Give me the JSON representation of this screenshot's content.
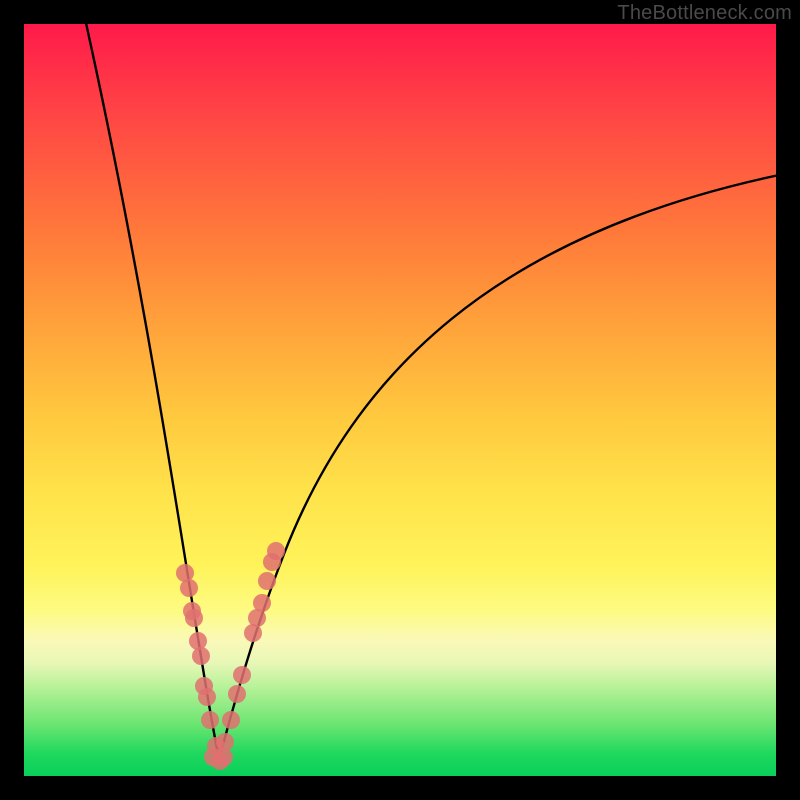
{
  "watermark": "TheBottleneck.com",
  "chart_data": {
    "type": "line",
    "title": "",
    "xlabel": "",
    "ylabel": "",
    "xlim": [
      0,
      100
    ],
    "ylim": [
      0,
      100
    ],
    "curve": {
      "name": "bottleneck-curve",
      "description": "V-shaped curve with minimum near x≈25",
      "x_min_at": 25,
      "left_branch_start_y": 100,
      "right_branch_end_y": 80
    },
    "series": [
      {
        "name": "left-dots",
        "x": [
          21.5,
          22.0,
          22.7,
          22.4,
          23.6,
          23.2,
          24.4,
          24.0,
          24.8,
          25.5
        ],
        "y": [
          27,
          25,
          21,
          22,
          16,
          18,
          10.5,
          12,
          7.5,
          4
        ]
      },
      {
        "name": "right-dots",
        "x": [
          26.8,
          27.5,
          29.0,
          28.3,
          30.5,
          31.6,
          32.3,
          31.0,
          33.0,
          33.6
        ],
        "y": [
          4.5,
          7.5,
          13.5,
          11,
          19,
          23,
          26,
          21,
          28.5,
          30
        ]
      },
      {
        "name": "bottom-dots",
        "x": [
          25.2,
          26.0,
          26.6
        ],
        "y": [
          2.5,
          2.0,
          2.5
        ]
      }
    ]
  }
}
